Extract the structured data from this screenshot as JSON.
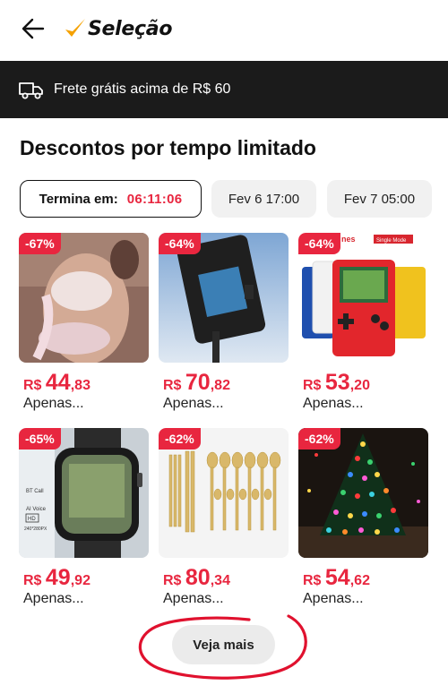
{
  "header": {
    "title": "Seleção",
    "back_icon": "arrow-left-icon",
    "logo_icon": "check-logo-icon",
    "accent": "#f5a100"
  },
  "shipping": {
    "icon": "truck-icon",
    "text": "Frete grátis acima de R$ 60"
  },
  "section": {
    "title": "Descontos por tempo limitado"
  },
  "time_tabs": [
    {
      "label": "Termina em:",
      "value": "06:11:06",
      "active": true
    },
    {
      "label": "Fev 6 17:00",
      "active": false
    },
    {
      "label": "Fev 7 05:00",
      "active": false
    }
  ],
  "products": [
    {
      "discount": "-67%",
      "currency": "R$",
      "price_int": "44",
      "price_dec": ",83",
      "subtitle": "Apenas..."
    },
    {
      "discount": "-64%",
      "currency": "R$",
      "price_int": "70",
      "price_dec": ",82",
      "subtitle": "Apenas..."
    },
    {
      "discount": "-64%",
      "currency": "R$",
      "price_int": "53",
      "price_dec": ",20",
      "subtitle": "Apenas..."
    },
    {
      "discount": "-65%",
      "currency": "R$",
      "price_int": "49",
      "price_dec": ",92",
      "subtitle": "Apenas..."
    },
    {
      "discount": "-62%",
      "currency": "R$",
      "price_int": "80",
      "price_dec": ",34",
      "subtitle": "Apenas..."
    },
    {
      "discount": "-62%",
      "currency": "R$",
      "price_int": "54",
      "price_dec": ",62",
      "subtitle": "Apenas..."
    }
  ],
  "product_image_texts": {
    "game_banner": "nes",
    "game_mode": "Single Mode",
    "watch_call": "BT Call",
    "watch_voice": "AI Voice",
    "watch_hd": "HD",
    "watch_res": "240*280PX"
  },
  "more": {
    "label": "Veja mais"
  },
  "colors": {
    "discount": "#e8263f",
    "shipbar": "#1b1b1b",
    "annotation": "#e0112e"
  }
}
